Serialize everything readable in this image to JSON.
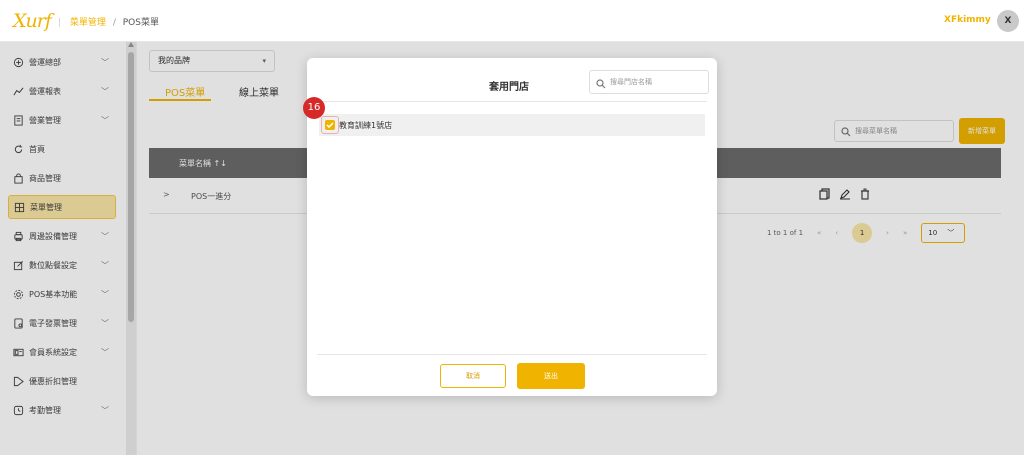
{
  "header": {
    "logo": "Xurf",
    "breadcrumb": [
      "菜單管理",
      "POS菜單"
    ],
    "username": "XFkimmy",
    "avatar_initial": "X"
  },
  "sidebar": {
    "items": [
      {
        "label": "營運總部",
        "icon": "plus-circle-icon",
        "has_chevron": true
      },
      {
        "label": "營運報表",
        "icon": "chart-icon",
        "has_chevron": true
      },
      {
        "label": "營業管理",
        "icon": "document-icon",
        "has_chevron": true
      },
      {
        "label": "首頁",
        "icon": "refresh-icon",
        "has_chevron": false
      },
      {
        "label": "商品管理",
        "icon": "bag-icon",
        "has_chevron": false
      },
      {
        "label": "菜單管理",
        "icon": "grid-icon",
        "has_chevron": false,
        "active": true
      },
      {
        "label": "周邊設備管理",
        "icon": "printer-icon",
        "has_chevron": true
      },
      {
        "label": "數位點餐設定",
        "icon": "edit-icon",
        "has_chevron": true
      },
      {
        "label": "POS基本功能",
        "icon": "gear-icon",
        "has_chevron": true
      },
      {
        "label": "電子發票管理",
        "icon": "invoice-icon",
        "has_chevron": true
      },
      {
        "label": "會員系統設定",
        "icon": "id-card-icon",
        "has_chevron": true
      },
      {
        "label": "優惠折扣管理",
        "icon": "tag-icon",
        "has_chevron": false
      },
      {
        "label": "考勤管理",
        "icon": "clock-icon",
        "has_chevron": true
      }
    ],
    "chevron": "﹀"
  },
  "main": {
    "brand_select": "我的品牌",
    "tabs": {
      "pos": "POS菜單",
      "online": "線上菜單"
    },
    "search_placeholder": "搜尋菜單名稱",
    "add_button": "新增菜單",
    "table_header": "菜單名稱 ↑↓",
    "row": {
      "expander": ">",
      "name": "POS一進分"
    },
    "pager": {
      "range": "1 to 1 of 1",
      "first": "«",
      "prev": "‹",
      "current": "1",
      "next": "›",
      "last": "»",
      "page_size": "10"
    }
  },
  "modal": {
    "title": "套用門店",
    "search_placeholder": "搜尋門店名稱",
    "store": {
      "label": "教育訓練1號店",
      "checked": true
    },
    "step_badge": "16",
    "cancel": "取消",
    "submit": "送出"
  },
  "colors": {
    "accent": "#f0b400",
    "badge": "#d62a2a",
    "table_header": "#6b6b6b"
  }
}
